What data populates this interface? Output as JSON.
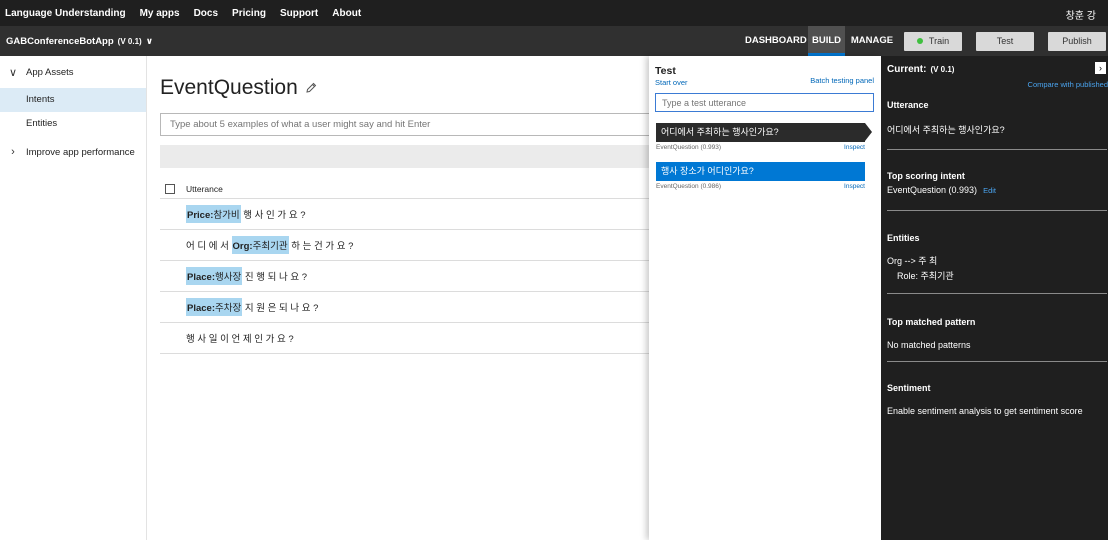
{
  "topnav": {
    "brand": "Language Understanding",
    "links": [
      "My apps",
      "Docs",
      "Pricing",
      "Support",
      "About"
    ],
    "user": "창훈 강"
  },
  "appbar": {
    "app_name": "GABConferenceBotApp",
    "version": "(V 0.1)",
    "tabs": [
      "DASHBOARD",
      "BUILD",
      "MANAGE"
    ],
    "active_tab": "BUILD",
    "train_label": "Train",
    "test_label": "Test",
    "publish_label": "Publish"
  },
  "sidebar": {
    "app_assets": "App Assets",
    "items": [
      "Intents",
      "Entities"
    ],
    "active_item": "Intents",
    "improve": "Improve app performance"
  },
  "main": {
    "title": "EventQuestion",
    "utterance_placeholder": "Type about 5 examples of what a user might say and hit Enter",
    "column_header": "Utterance",
    "utterances": [
      {
        "segments": [
          {
            "entity": "Price",
            "text": "참가비"
          },
          {
            "text": " 행 사 인 가 요 ?"
          }
        ]
      },
      {
        "segments": [
          {
            "text": "어 디 에 서 "
          },
          {
            "entity": "Org",
            "text": "주최기관"
          },
          {
            "text": " 하 는 건 가 요 ?"
          }
        ]
      },
      {
        "segments": [
          {
            "entity": "Place",
            "text": "행사장"
          },
          {
            "text": " 진 행 되 나 요 ?"
          }
        ]
      },
      {
        "segments": [
          {
            "entity": "Place",
            "text": "주차장"
          },
          {
            "text": " 지 원 은 되 나 요 ?"
          }
        ]
      },
      {
        "segments": [
          {
            "text": "행 사 일 이 언 제 인 가 요 ?"
          }
        ]
      }
    ]
  },
  "test_panel": {
    "title": "Test",
    "start_over": "Start over",
    "batch": "Batch testing panel",
    "input_placeholder": "Type a test utterance",
    "results": [
      {
        "text": "어디에서 주최하는 행사인가요?",
        "intent": "EventQuestion (0.993)",
        "inspect": "Inspect",
        "style": "dark"
      },
      {
        "text": "행사 장소가 어디인가요?",
        "intent": "EventQuestion (0.986)",
        "inspect": "Inspect",
        "style": "blue"
      }
    ]
  },
  "inspect_panel": {
    "current_label": "Current:",
    "current_version": "(V 0.1)",
    "compare_link": "Compare with published",
    "utterance_heading": "Utterance",
    "utterance": "어디에서 주최하는 행사인가요?",
    "top_intent_heading": "Top scoring intent",
    "top_intent": "EventQuestion (0.993)",
    "edit_label": "Edit",
    "entities_heading": "Entities",
    "entity_line": "Org --> 주 최",
    "entity_role": "Role: 주최기관",
    "pattern_heading": "Top matched pattern",
    "pattern_text": "No matched patterns",
    "sentiment_heading": "Sentiment",
    "sentiment_text": "Enable sentiment analysis to get sentiment score"
  },
  "colors": {
    "accent": "#0078d4",
    "entity_highlight": "#a9d6f0",
    "train_dot": "#3fbf3f"
  }
}
